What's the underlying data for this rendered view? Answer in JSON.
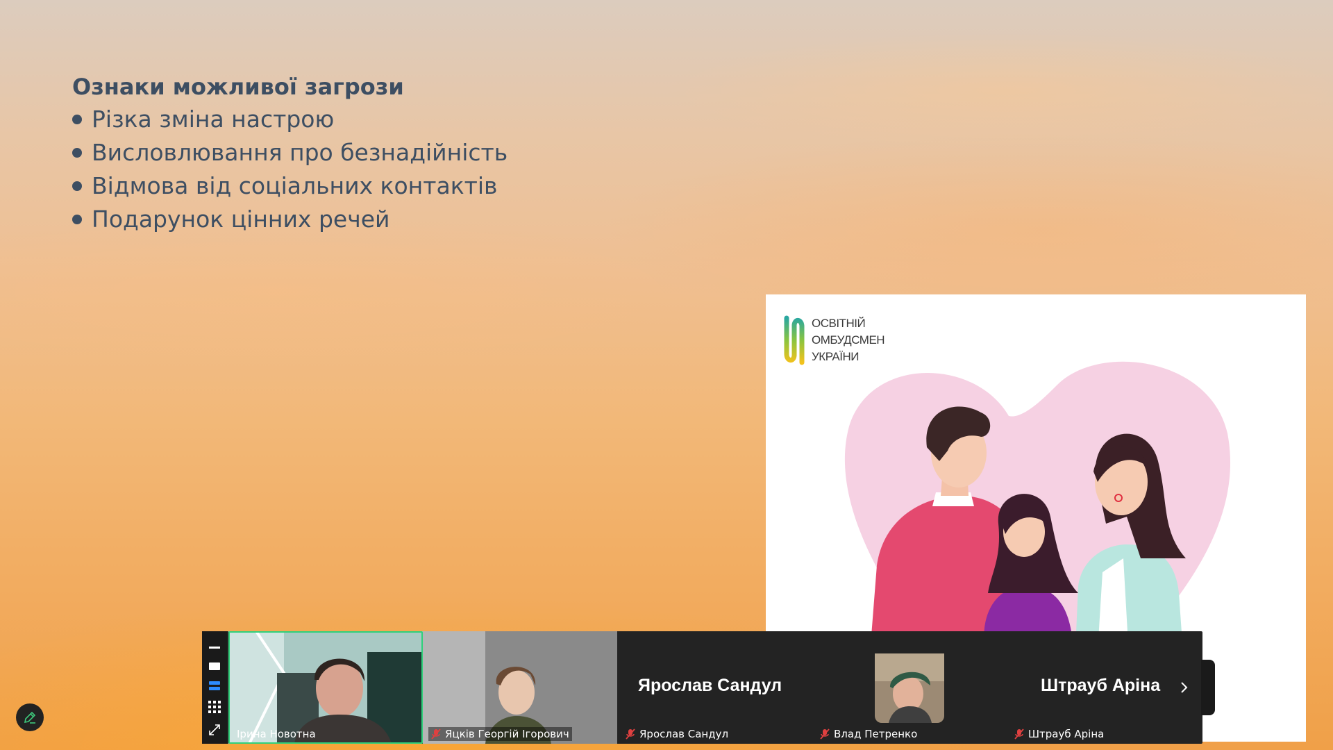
{
  "slide": {
    "title": "Ознаки можливої загрози",
    "bullets": [
      "Різка зміна настрою",
      "Висловлювання про безнадійність",
      "Відмова від соціальних контактів",
      "Подарунок цінних речей"
    ]
  },
  "picture": {
    "logo_lines": [
      "ОСВІТНІЙ",
      "ОМБУДСМЕН",
      "УКРАЇНИ"
    ]
  },
  "participants": [
    {
      "name": "Ірина Новотна",
      "muted": false,
      "active": true,
      "type": "video"
    },
    {
      "name": "Яцків Георгій Ігорович",
      "muted": true,
      "active": false,
      "type": "video"
    },
    {
      "name": "Ярослав Сандул",
      "big_name": "Ярослав Сандул",
      "muted": true,
      "type": "name"
    },
    {
      "name": "Влад Петренко",
      "muted": true,
      "type": "avatar"
    },
    {
      "name": "Штрауб Аріна",
      "big_name": "Штрауб Аріна",
      "muted": true,
      "type": "name"
    }
  ],
  "icons": {
    "annotate": "pencil-icon",
    "next": "chevron-right-icon",
    "mic_off": "mic-off-icon"
  },
  "colors": {
    "active_speaker_border": "#2fd07a",
    "mic_off": "#e04040",
    "slide_text": "#3d4e62"
  }
}
